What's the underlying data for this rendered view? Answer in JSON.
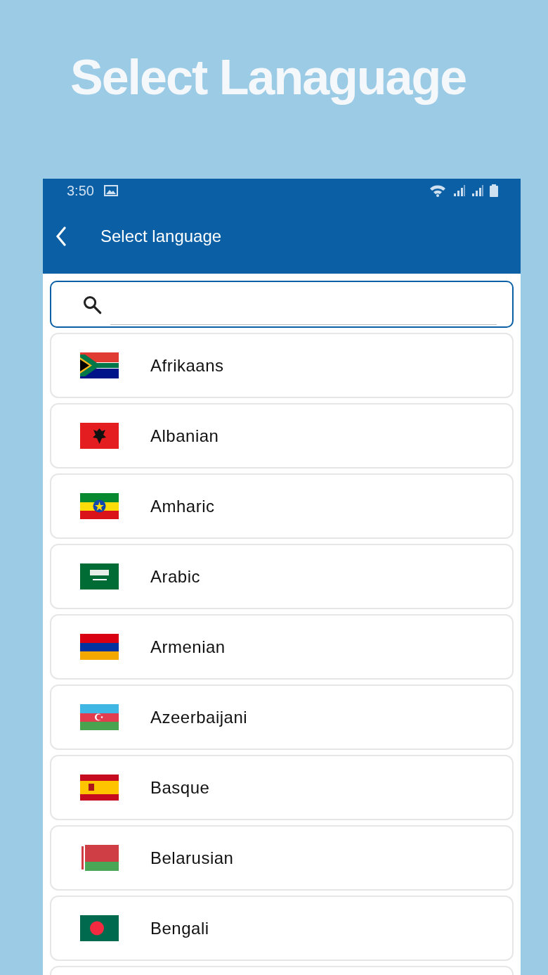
{
  "heading": "Select Lanaguage",
  "status_bar": {
    "time": "3:50"
  },
  "app_bar": {
    "title": "Select language"
  },
  "languages": [
    "Afrikaans",
    "Albanian",
    "Amharic",
    "Arabic",
    "Armenian",
    "Azeerbaijani",
    "Basque",
    "Belarusian",
    "Bengali"
  ]
}
